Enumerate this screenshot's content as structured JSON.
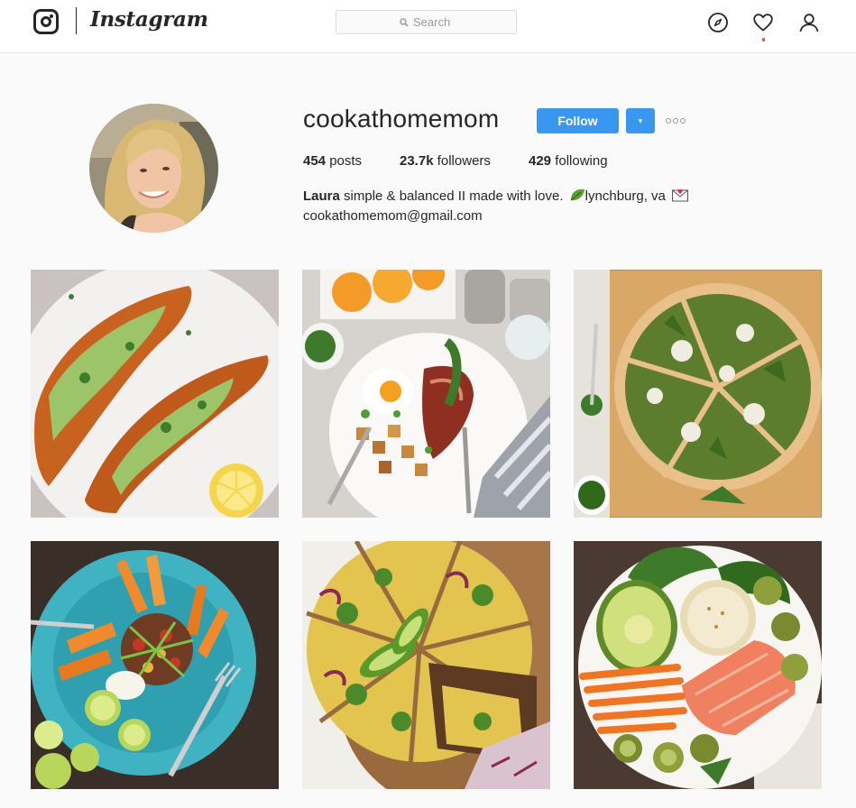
{
  "nav": {
    "brand": "Instagram",
    "search_placeholder": "Search",
    "icons": [
      "instagram-logo-icon",
      "search-icon",
      "compass-icon",
      "heart-icon",
      "user-icon"
    ],
    "notification_color": "#ed4956"
  },
  "profile": {
    "username": "cookathomemom",
    "follow_label": "Follow",
    "dropdown_glyph": "▾",
    "stats": [
      {
        "count": "454",
        "label": "posts"
      },
      {
        "count": "23.7k",
        "label": "followers"
      },
      {
        "count": "429",
        "label": "following"
      }
    ],
    "bio": {
      "name": "Laura",
      "text": "simple & balanced II made with love.",
      "location": "lynchburg, va",
      "email": "cookathomemom@gmail.com"
    }
  },
  "posts": [
    {
      "name": "sweet-potato-toast"
    },
    {
      "name": "breakfast-plate"
    },
    {
      "name": "pesto-pizza"
    },
    {
      "name": "sweet-potato-bowl"
    },
    {
      "name": "spinach-frittata"
    },
    {
      "name": "salmon-bowl"
    }
  ],
  "colors": {
    "accent": "#3897f0",
    "text": "#262626",
    "background": "#fafafa",
    "border": "#dbdbdb"
  }
}
